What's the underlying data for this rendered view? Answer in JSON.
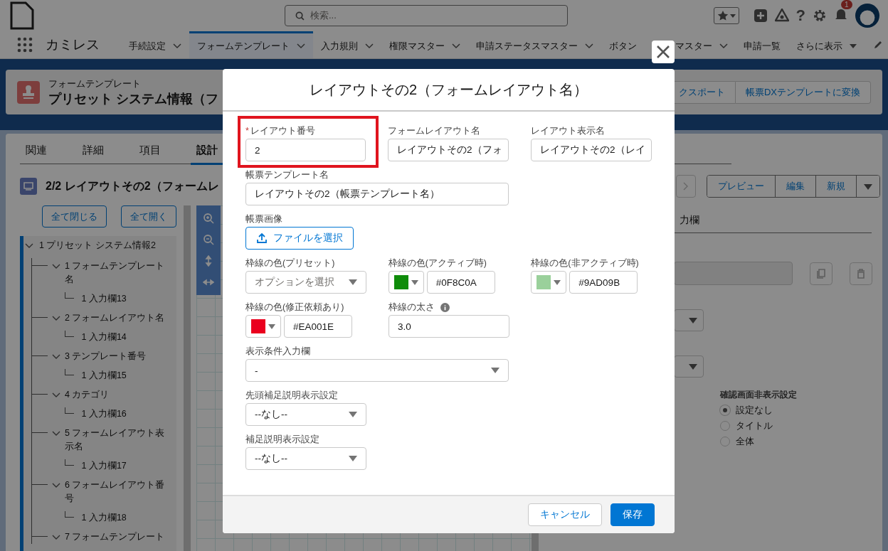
{
  "global_header": {
    "search": {
      "placeholder": "検索..."
    },
    "help": "?",
    "notification_badge": "1"
  },
  "nav": {
    "app_name": "カミレス",
    "tabs": [
      {
        "label": "手続設定",
        "selected": false,
        "kind": "menu"
      },
      {
        "label": "フォームテンプレート",
        "selected": true,
        "kind": "menu"
      },
      {
        "label": "入力規則",
        "selected": false,
        "kind": "menu"
      },
      {
        "label": "権限マスター",
        "selected": false,
        "kind": "menu"
      },
      {
        "label": "申請ステータスマスター",
        "selected": false,
        "kind": "menu"
      },
      {
        "label": "ボタン",
        "label_end": "マスター",
        "selected": false,
        "kind": "menu"
      },
      {
        "label": "申請一覧",
        "selected": false,
        "kind": "plain"
      },
      {
        "label": "さらに表示",
        "selected": false,
        "kind": "more"
      }
    ]
  },
  "record": {
    "object_label": "フォームテンプレート",
    "title": "プリセット システム情報（フ",
    "actions": [
      "クスポート",
      "帳票DXテンプレートに変換"
    ]
  },
  "record_tabs": [
    {
      "label": "関連",
      "selected": false
    },
    {
      "label": "詳細",
      "selected": false
    },
    {
      "label": "項目",
      "selected": false
    },
    {
      "label": "設計",
      "selected": true
    }
  ],
  "layout_heading": "2/2 レイアウトその2（フォームレ",
  "tree_buttons": [
    "全て閉じる",
    "全て開く"
  ],
  "tree": [
    {
      "label": "1 プリセット システム情報2",
      "expanded": true,
      "children": [
        {
          "label": "1 フォームテンプレート名",
          "expanded": true,
          "children": [
            {
              "label": "1 入力欄13"
            }
          ]
        },
        {
          "label": "2 フォームレイアウト名",
          "expanded": true,
          "children": [
            {
              "label": "1 入力欄14"
            }
          ]
        },
        {
          "label": "3 テンプレート番号",
          "expanded": true,
          "children": [
            {
              "label": "1 入力欄15"
            }
          ]
        },
        {
          "label": "4 カテゴリ",
          "expanded": true,
          "children": [
            {
              "label": "1 入力欄16"
            }
          ]
        },
        {
          "label": "5 フォームレイアウト表示名",
          "expanded": true,
          "children": [
            {
              "label": "1 入力欄17"
            }
          ]
        },
        {
          "label": "6 フォームレイアウト番号",
          "expanded": true,
          "children": [
            {
              "label": "1 入力欄18"
            }
          ]
        },
        {
          "label": "7 フォームテンプレート",
          "expanded": true
        }
      ]
    }
  ],
  "right_panel": {
    "actions": [
      "プレビュー",
      "編集",
      "新規"
    ],
    "tab": "力欄",
    "radio_group": {
      "label": "確認画面非表示設定",
      "options": [
        {
          "label": "設定なし",
          "selected": true
        },
        {
          "label": "タイトル",
          "selected": false
        },
        {
          "label": "全体",
          "selected": false
        }
      ]
    }
  },
  "modal": {
    "title": "レイアウトその2（フォームレイアウト名）",
    "rows": [
      [
        {
          "kind": "text",
          "label": "レイアウト番号",
          "required_mark": "*",
          "value": "2",
          "highlighted": true
        },
        {
          "kind": "text",
          "label": "フォームレイアウト名",
          "value": "レイアウトその2（フォ"
        },
        {
          "kind": "text",
          "label": "レイアウト表示名",
          "value": "レイアウトその2（レイ"
        }
      ],
      [
        {
          "kind": "text",
          "label": "帳票テンプレート名",
          "value": "レイアウトその2（帳票テンプレート名）",
          "wide": true
        }
      ],
      [
        {
          "kind": "file",
          "label": "帳票画像",
          "button": "ファイルを選択"
        }
      ],
      [
        {
          "kind": "select",
          "label": "枠線の色(プリセット)",
          "placeholder": "オプションを選択"
        },
        {
          "kind": "color",
          "label": "枠線の色(アクティブ時)",
          "color": "#0f8c0a",
          "value": "#0F8C0A"
        },
        {
          "kind": "color",
          "label": "枠線の色(非アクティブ時)",
          "color": "#9ad09b",
          "value": "#9AD09B"
        }
      ],
      [
        {
          "kind": "color",
          "label": "枠線の色(修正依頼あり)",
          "color": "#ea001e",
          "value": "#EA001E"
        },
        {
          "kind": "text",
          "label": "枠線の太さ",
          "value": "3.0",
          "info": true
        }
      ],
      [
        {
          "kind": "select",
          "label": "表示条件入力欄",
          "value": "-",
          "wide": true
        }
      ],
      [
        {
          "kind": "select",
          "label": "先頭補足説明表示設定",
          "value": "--なし--"
        }
      ],
      [
        {
          "kind": "select",
          "label": "補足説明表示設定",
          "value": "--なし--"
        }
      ]
    ],
    "buttons": [
      {
        "label": "キャンセル",
        "kind": "neutral"
      },
      {
        "label": "保存",
        "kind": "brand"
      }
    ]
  }
}
